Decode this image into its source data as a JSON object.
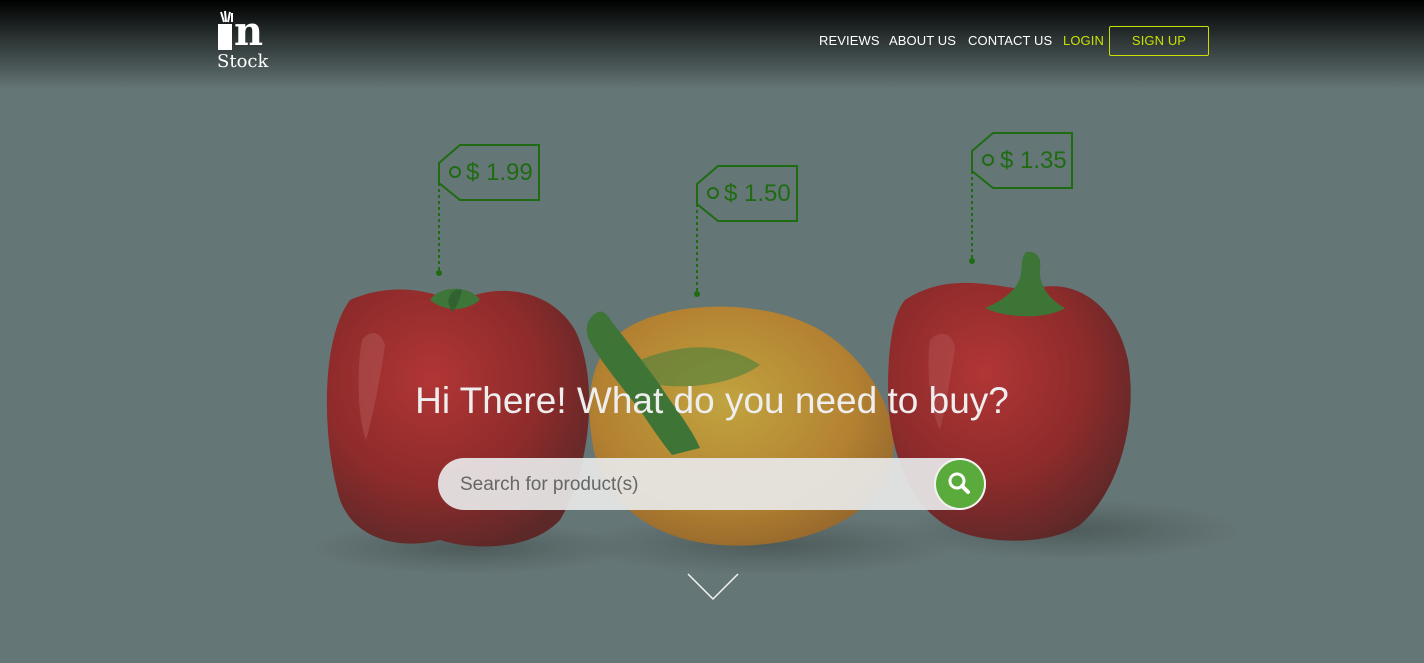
{
  "brand": {
    "logo_text": "Stock",
    "logo_mark": "n"
  },
  "nav": {
    "reviews": "REVIEWS",
    "about": "ABOUT US",
    "contact": "CONTACT US",
    "login": "LOGIN",
    "signup": "SIGN UP"
  },
  "price_tags": [
    {
      "label": "$ 1.99"
    },
    {
      "label": "$ 1.50"
    },
    {
      "label": "$ 1.35"
    }
  ],
  "hero": {
    "headline": "Hi There! What do you need to buy?",
    "search_placeholder": "Search for product(s)"
  },
  "colors": {
    "accent": "#c8e000",
    "search_button": "#5aaa3c",
    "tag": "#1f6b12",
    "pepper_red": "#b50b0b",
    "pepper_yellow": "#e89a10"
  },
  "icons": {
    "search": "magnifier-icon",
    "scroll": "chevron-down-icon"
  }
}
